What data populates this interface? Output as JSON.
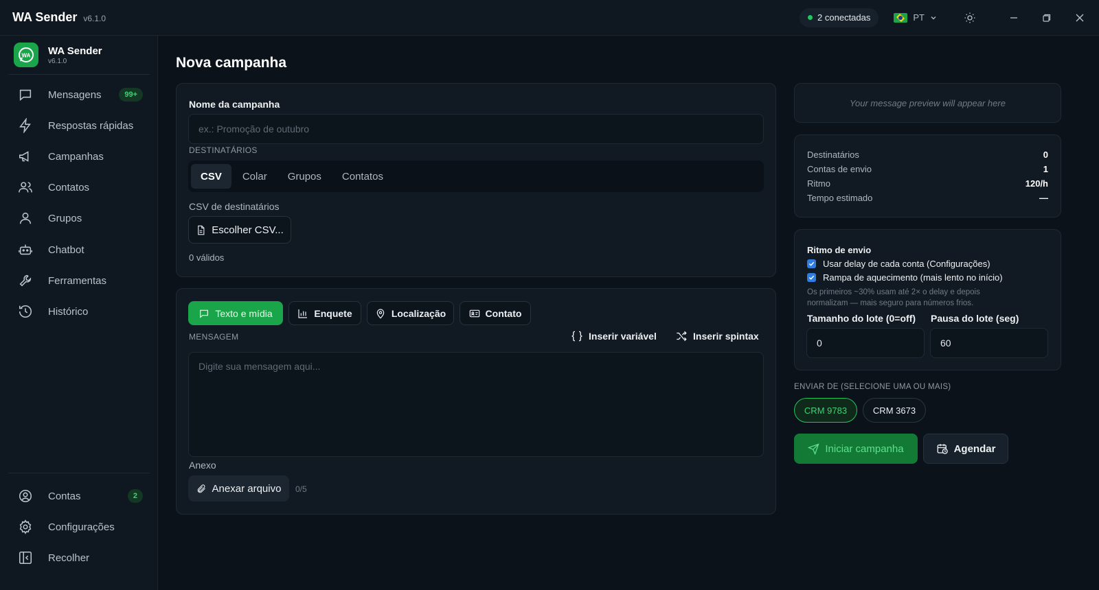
{
  "titlebar": {
    "app_name": "WA Sender",
    "version": "v6.1.0",
    "connected": "2 conectadas",
    "language": "PT"
  },
  "sidebar": {
    "brand_name": "WA Sender",
    "brand_version": "v6.1.0",
    "logo_text": "WA",
    "items": [
      {
        "label": "Mensagens",
        "icon": "message-icon",
        "badge": "99+"
      },
      {
        "label": "Respostas rápidas",
        "icon": "bolt-icon"
      },
      {
        "label": "Campanhas",
        "icon": "megaphone-icon"
      },
      {
        "label": "Contatos",
        "icon": "users-icon"
      },
      {
        "label": "Grupos",
        "icon": "group-icon"
      },
      {
        "label": "Chatbot",
        "icon": "bot-icon"
      },
      {
        "label": "Ferramentas",
        "icon": "wrench-icon"
      },
      {
        "label": "Histórico",
        "icon": "history-icon"
      }
    ],
    "bottom_items": [
      {
        "label": "Contas",
        "icon": "account-icon",
        "badge": "2"
      },
      {
        "label": "Configurações",
        "icon": "gear-icon"
      },
      {
        "label": "Recolher",
        "icon": "collapse-icon"
      }
    ]
  },
  "main": {
    "title": "Nova campanha",
    "campaign": {
      "name_label": "Nome da campanha",
      "name_placeholder": "ex.: Promoção de outubro",
      "recipients_label": "DESTINATÁRIOS",
      "recipient_tabs": [
        "CSV",
        "Colar",
        "Grupos",
        "Contatos"
      ],
      "active_tab": "CSV",
      "csv_label": "CSV de destinatários",
      "csv_button": "Escolher CSV...",
      "valid_count": "0 válidos"
    },
    "message": {
      "type_tabs": [
        "Texto e mídia",
        "Enquete",
        "Localização",
        "Contato"
      ],
      "active_type": "Texto e mídia",
      "message_label": "MENSAGEM",
      "insert_variable": "Inserir variável",
      "insert_spintax": "Inserir spintax",
      "message_placeholder": "Digite sua mensagem aqui...",
      "attachment_label": "Anexo",
      "attach_button": "Anexar arquivo",
      "attach_count": "0/5"
    }
  },
  "right": {
    "preview_placeholder": "Your message preview will appear here",
    "stats": [
      {
        "label": "Destinatários",
        "value": "0"
      },
      {
        "label": "Contas de envio",
        "value": "1"
      },
      {
        "label": "Ritmo",
        "value": "120/h"
      },
      {
        "label": "Tempo estimado",
        "value": "—"
      }
    ],
    "pace": {
      "title": "Ritmo de envio",
      "option1": "Usar delay de cada conta (Configurações)",
      "option2": "Rampa de aquecimento (mais lento no início)",
      "hint": "Os primeiros ~30% usam até 2× o delay e depois normalizam — mais seguro para números frios.",
      "batch_size_label": "Tamanho do lote (0=off)",
      "batch_size_value": "0",
      "batch_pause_label": "Pausa do lote (seg)",
      "batch_pause_value": "60"
    },
    "send_from": {
      "label": "ENVIAR DE (SELECIONE UMA OU MAIS)",
      "accounts": [
        {
          "name": "CRM 9783",
          "selected": true
        },
        {
          "name": "CRM 3673",
          "selected": false
        }
      ]
    },
    "start_button": "Iniciar campanha",
    "schedule_button": "Agendar"
  },
  "colors": {
    "accent_green": "#1aa54a",
    "background": "#0b121a",
    "panel": "#111a23"
  }
}
